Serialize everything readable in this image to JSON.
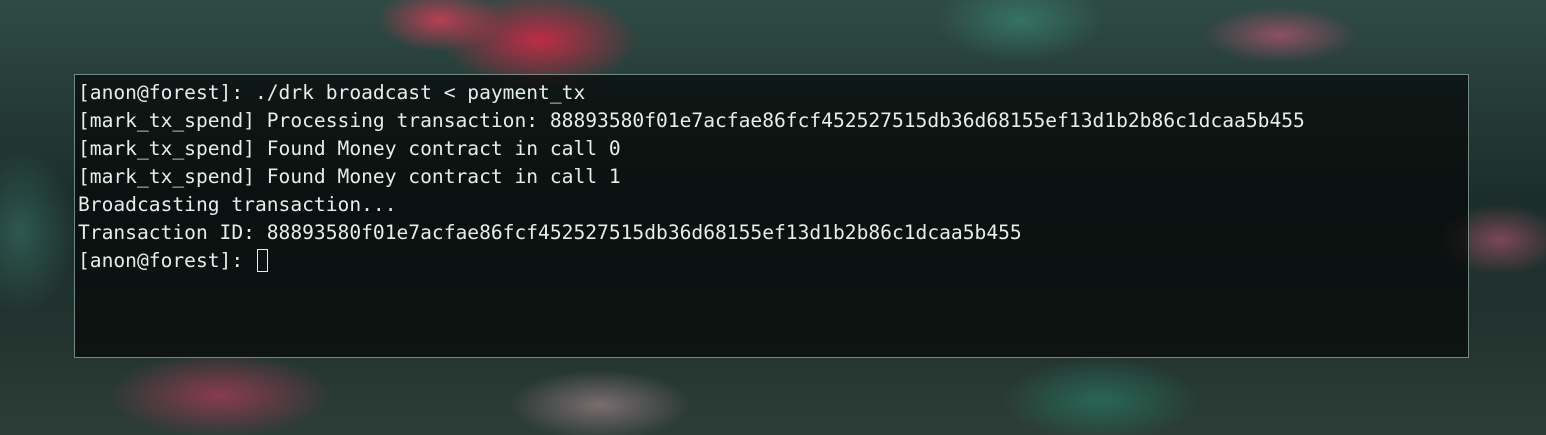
{
  "terminal": {
    "lines": [
      "[anon@forest]: ./drk broadcast < payment_tx",
      "[mark_tx_spend] Processing transaction: 88893580f01e7acfae86fcf452527515db36d68155ef13d1b2b86c1dcaa5b455",
      "[mark_tx_spend] Found Money contract in call 0",
      "[mark_tx_spend] Found Money contract in call 1",
      "Broadcasting transaction...",
      "Transaction ID: 88893580f01e7acfae86fcf452527515db36d68155ef13d1b2b86c1dcaa5b455"
    ],
    "prompt": "[anon@forest]: "
  }
}
